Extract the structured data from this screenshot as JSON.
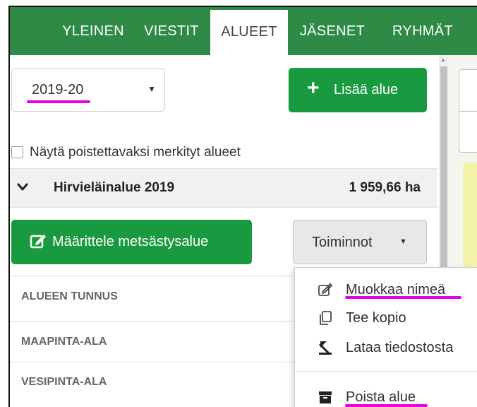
{
  "nav": {
    "tabs": [
      {
        "label": "YLEINEN",
        "active": false
      },
      {
        "label": "VIESTIT",
        "active": false
      },
      {
        "label": "ALUEET",
        "active": true
      },
      {
        "label": "JÄSENET",
        "active": false
      },
      {
        "label": "RYHMÄT",
        "active": false
      }
    ]
  },
  "season_select": {
    "value": "2019-20"
  },
  "add_area_button": {
    "label": "Lisää alue",
    "icon": "plus-icon"
  },
  "show_deleted": {
    "label": "Näytä poistettavaksi merkityt alueet",
    "checked": false
  },
  "area": {
    "name": "Hirvieläinalue 2019",
    "size": "1 959,66 ha",
    "expanded": true
  },
  "define_button": {
    "label": "Määrittele metsästysalue",
    "icon": "edit-icon"
  },
  "tools_button": {
    "label": "Toiminnot"
  },
  "info_rows": [
    "ALUEEN TUNNUS",
    "MAAPINTA-ALA",
    "VESIPINTA-ALA"
  ],
  "menu": {
    "items": [
      {
        "label": "Muokkaa nimeä",
        "icon": "pencil-square-icon"
      },
      {
        "label": "Tee kopio",
        "icon": "copy-icon"
      },
      {
        "label": "Lataa tiedostosta",
        "icon": "upload-icon"
      },
      {
        "label": "Poista alue",
        "icon": "archive-icon"
      }
    ]
  },
  "colors": {
    "nav_green": "#2e8a45",
    "button_green": "#1a9a40",
    "highlight_magenta": "#e600e6"
  }
}
